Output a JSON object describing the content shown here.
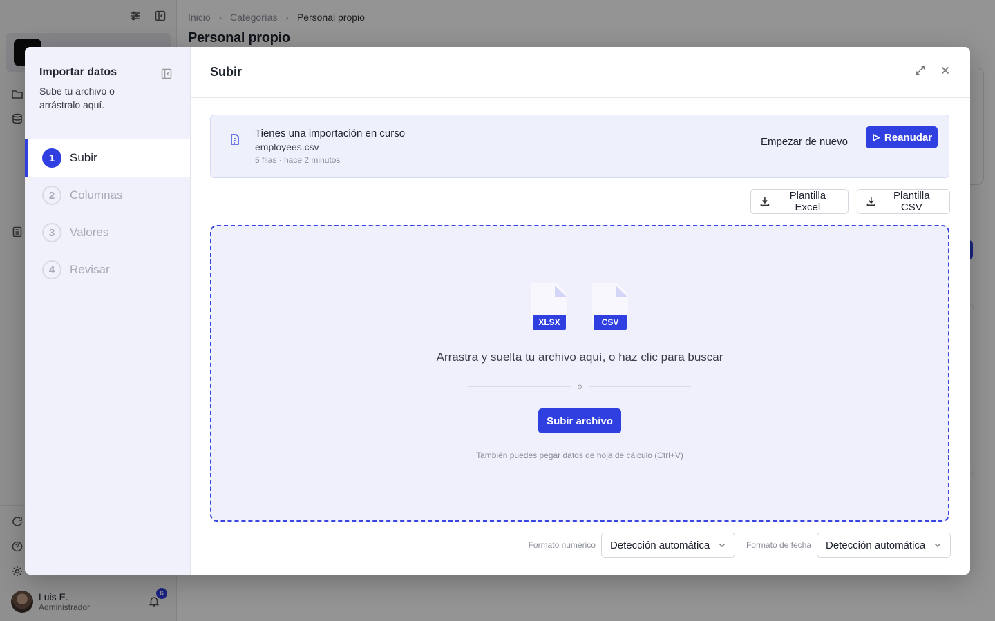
{
  "app": {
    "breadcrumb": [
      "Inicio",
      "Categorías",
      "Personal propio"
    ],
    "page_title": "Personal propio",
    "user": {
      "name": "Luis E.",
      "role": "Administrador",
      "notifications": "6"
    }
  },
  "modal": {
    "sidebar": {
      "title": "Importar datos",
      "subtitle": "Sube tu archivo o arrástralo aquí.",
      "steps": [
        {
          "number": "1",
          "label": "Subir",
          "active": true
        },
        {
          "number": "2",
          "label": "Columnas",
          "active": false
        },
        {
          "number": "3",
          "label": "Valores",
          "active": false
        },
        {
          "number": "4",
          "label": "Revisar",
          "active": false
        }
      ]
    },
    "title": "Subir",
    "resume": {
      "title": "Tienes una importación en curso",
      "file": "employees.csv",
      "meta": "5 filas · hace 2 minutos",
      "restart_label": "Empezar de nuevo",
      "resume_label": "Reanudar"
    },
    "templates": {
      "excel_label": "Plantilla Excel",
      "csv_label": "Plantilla CSV"
    },
    "dropzone": {
      "file_types": [
        "XLSX",
        "CSV"
      ],
      "text": "Arrastra y suelta tu archivo aquí, o haz clic para buscar",
      "or": "o",
      "upload_label": "Subir archivo",
      "paste_hint": "También puedes pegar datos de hoja de cálculo (Ctrl+V)"
    },
    "formats": {
      "number_label": "Formato numérico",
      "number_value": "Detección automática",
      "date_label": "Formato de fecha",
      "date_value": "Detección automática"
    }
  },
  "colors": {
    "accent": "#2f3fe0",
    "banner_bg": "#eef0fc",
    "dropzone_bg": "#eff0fb"
  }
}
